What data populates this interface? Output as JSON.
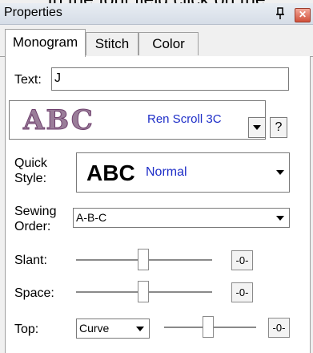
{
  "caption": "In the font field click on the",
  "window": {
    "title": "Properties"
  },
  "tabs": [
    {
      "label": "Monogram"
    },
    {
      "label": "Stitch"
    },
    {
      "label": "Color"
    }
  ],
  "monogram": {
    "text_label": "Text:",
    "text_value": "J",
    "font_preview": "ABC",
    "font_name": "Ren Scroll 3C",
    "help_label": "?",
    "quick_style_label_1": "Quick",
    "quick_style_label_2": "Style:",
    "quick_style_preview": "ABC",
    "quick_style_value": "Normal",
    "sewing_order_label_1": "Sewing",
    "sewing_order_label_2": "Order:",
    "sewing_order_value": "A-B-C",
    "slant_label": "Slant:",
    "slant_reset": "-0-",
    "space_label": "Space:",
    "space_reset": "-0-",
    "top_label": "Top:",
    "top_value": "Curve",
    "top_reset": "-0-"
  }
}
